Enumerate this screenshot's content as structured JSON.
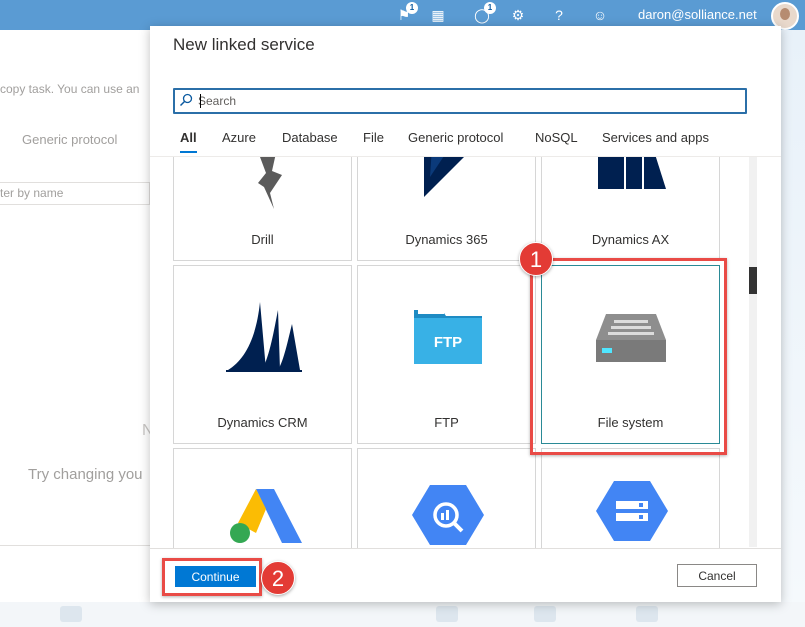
{
  "topbar": {
    "notification_count": "1",
    "feedback_count": "1",
    "user_email": "daron@solliance.net",
    "icons": [
      "notifications-icon",
      "directory-icon",
      "feedback-icon",
      "settings-icon",
      "help-icon",
      "smiley-icon"
    ]
  },
  "background_page": {
    "description": "copy task. You can use an",
    "tab_label": "Generic protocol",
    "filter_placeholder": "ter by name",
    "no_results_partial": "N",
    "try_changing": "Try changing you"
  },
  "dialog": {
    "title": "New linked service",
    "search": {
      "placeholder": "Search",
      "value": ""
    },
    "tabs": [
      {
        "label": "All",
        "active": true
      },
      {
        "label": "Azure"
      },
      {
        "label": "Database"
      },
      {
        "label": "File"
      },
      {
        "label": "Generic protocol"
      },
      {
        "label": "NoSQL"
      },
      {
        "label": "Services and apps"
      }
    ],
    "tiles": [
      {
        "label": "Drill",
        "icon": "drill-icon"
      },
      {
        "label": "Dynamics 365",
        "icon": "dynamics-365-icon"
      },
      {
        "label": "Dynamics AX",
        "icon": "dynamics-ax-icon"
      },
      {
        "label": "Dynamics CRM",
        "icon": "dynamics-crm-icon"
      },
      {
        "label": "FTP",
        "icon": "ftp-icon",
        "icon_text": "FTP"
      },
      {
        "label": "File system",
        "icon": "file-system-icon",
        "selected": true
      },
      {
        "label": "",
        "icon": "google-ads-icon"
      },
      {
        "label": "",
        "icon": "google-bigquery-icon"
      },
      {
        "label": "",
        "icon": "google-cloud-storage-icon"
      }
    ],
    "continue_label": "Continue",
    "cancel_label": "Cancel"
  },
  "callouts": {
    "step1": "1",
    "step2": "2"
  },
  "colors": {
    "accent": "#0078d4",
    "callout": "#e33b35",
    "topbar": "#5a9bd3"
  }
}
